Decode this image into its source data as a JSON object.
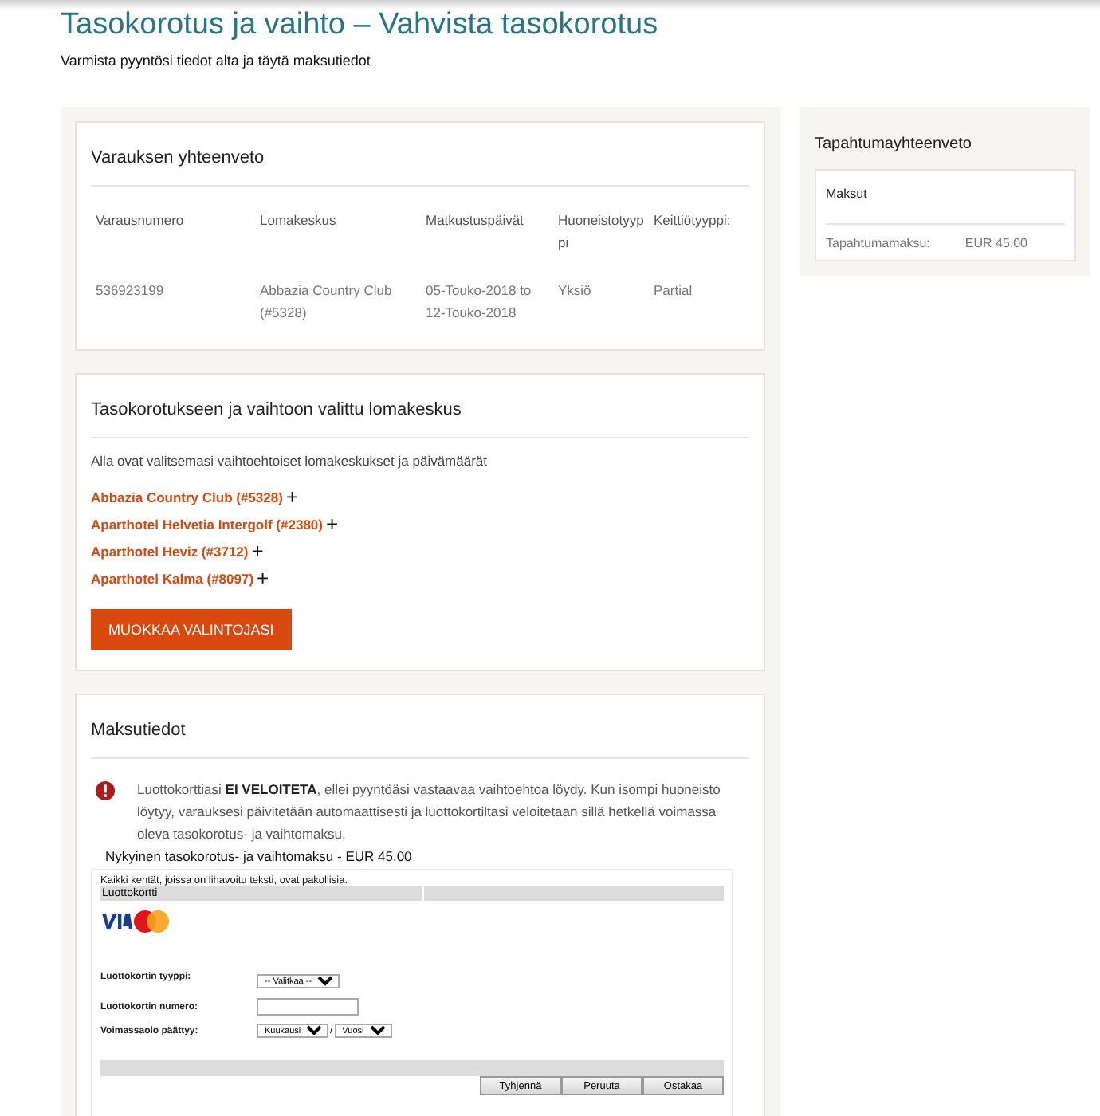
{
  "header": {
    "title": "Tasokorotus ja vaihto – Vahvista tasokorotus",
    "subtitle": "Varmista pyyntösi tiedot alta ja täytä maksutiedot"
  },
  "reservation": {
    "title": "Varauksen yhteenveto",
    "columns": [
      "Varausnumero",
      "Lomakeskus",
      "Matkustuspäivät",
      "Huoneistotyyppi",
      "Keittiötyyppi:"
    ],
    "row": [
      "536923199",
      "Abbazia Country Club (#5328)",
      "05-Touko-2018 to 12-Touko-2018",
      "Yksiö",
      "Partial"
    ]
  },
  "resorts": {
    "title": "Tasokorotukseen ja vaihtoon valittu lomakeskus",
    "intro": "Alla ovat valitsemasi vaihtoehtoiset lomakeskukset ja päivämäärät",
    "items": [
      {
        "name": "Abbazia Country Club (#5328)",
        "expand": "+"
      },
      {
        "name": "Aparthotel Helvetia Intergolf (#2380)",
        "expand": "+"
      },
      {
        "name": "Aparthotel Heviz (#3712)",
        "expand": "+"
      },
      {
        "name": "Aparthotel Kalma (#8097)",
        "expand": "+"
      }
    ],
    "edit_button": "MUOKKAA VALINTOJASI"
  },
  "payment": {
    "title": "Maksutiedot",
    "notice": "Luottokorttiasi **EI VELOITETA**, ellei pyyntöäsi vastaavaa vaihtoehtoa löydy. Kun isompi huoneisto löytyy, varauksesi päivitetään automaattisesti ja luottokortiltasi veloitetaan sillä hetkellä voimassa oleva tasokorotus- ja vaihtomaksu.",
    "fee": "Nykyinen tasokorotus- ja vaihtomaksu - EUR 45.00",
    "form": {
      "required_note": "Kaikki kentät, joissa on lihavoitu teksti, ovat pakollisia.",
      "section": "Luottokortti",
      "card_type": {
        "label": "Luottokortin tyyppi:",
        "value": "-- Valitkaa --"
      },
      "card_number": {
        "label": "Luottokortin numero:"
      },
      "expiry": {
        "label": "Voimassaolo päättyy:",
        "month": "Kuukausi",
        "separator": "/",
        "year": "Vuosi"
      },
      "buttons": [
        "Tyhjennä",
        "Peruuta",
        "Ostakaa"
      ]
    }
  },
  "summary": {
    "title": "Tapahtumayhteenveto",
    "fees_title": "Maksut",
    "fee_label": "Tapahtumamaksu:",
    "fee_value": "EUR 45.00"
  }
}
